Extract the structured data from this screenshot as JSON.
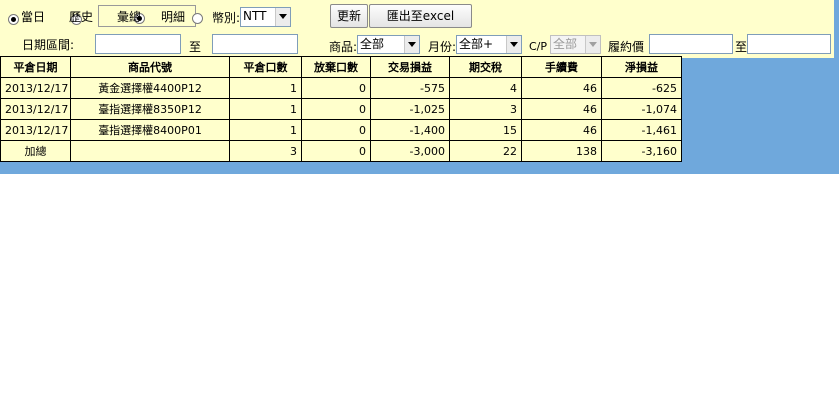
{
  "filters": {
    "scope_current_label": "當日",
    "scope_history_label": "歷史",
    "view_summary_label": "彙總",
    "view_detail_label": "明細",
    "currency_label": "幣別:",
    "currency_value": "NTT",
    "date_range_label": "日期區間:",
    "date_to_label": "至",
    "date_from_value": "",
    "date_end_value": "",
    "product_label": "商品:",
    "product_value": "全部",
    "month_label": "月份:",
    "month_value": "全部+",
    "cp_label": "C/P",
    "cp_value": "全部",
    "strike_label": "履約價",
    "strike_to_label": "至",
    "strike_from_value": "",
    "strike_end_value": ""
  },
  "buttons": {
    "refresh_label": "更新",
    "export_label": "匯出至excel"
  },
  "table": {
    "headers": [
      "平倉日期",
      "商品代號",
      "平倉口數",
      "放棄口數",
      "交易損益",
      "期交稅",
      "手續費",
      "淨損益"
    ],
    "rows": [
      [
        "2013/12/17",
        "黃金選擇權4400P12",
        "1",
        "0",
        "-575",
        "4",
        "46",
        "-625"
      ],
      [
        "2013/12/17",
        "臺指選擇權8350P12",
        "1",
        "0",
        "-1,025",
        "3",
        "46",
        "-1,074"
      ],
      [
        "2013/12/17",
        "臺指選擇權8400P01",
        "1",
        "0",
        "-1,400",
        "15",
        "46",
        "-1,461"
      ]
    ],
    "total": [
      "加總",
      "",
      "3",
      "0",
      "-3,000",
      "22",
      "138",
      "-3,160"
    ]
  },
  "colors": {
    "filter_background": "#ffffcc",
    "panel_background": "#6fa8dc"
  }
}
